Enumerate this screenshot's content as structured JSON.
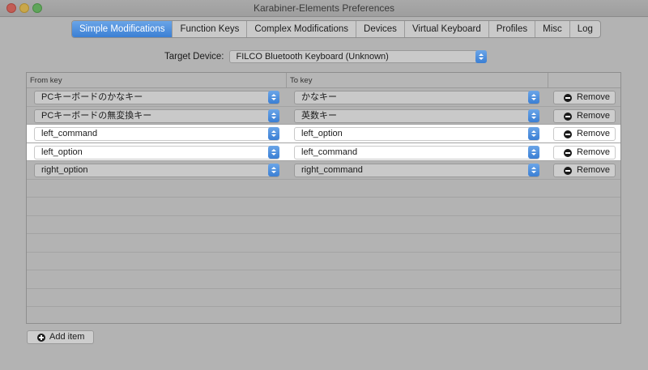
{
  "window": {
    "title": "Karabiner-Elements Preferences"
  },
  "tabs": [
    {
      "label": "Simple Modifications",
      "active": true
    },
    {
      "label": "Function Keys",
      "active": false
    },
    {
      "label": "Complex Modifications",
      "active": false
    },
    {
      "label": "Devices",
      "active": false
    },
    {
      "label": "Virtual Keyboard",
      "active": false
    },
    {
      "label": "Profiles",
      "active": false
    },
    {
      "label": "Misc",
      "active": false
    },
    {
      "label": "Log",
      "active": false
    }
  ],
  "target_device": {
    "label": "Target Device:",
    "value": "FILCO Bluetooth Keyboard (Unknown)"
  },
  "table": {
    "headers": {
      "from": "From key",
      "to": "To key"
    },
    "rows": [
      {
        "from": "PCキーボードのかなキー",
        "to": "かなキー",
        "remove": "Remove",
        "highlighted": false
      },
      {
        "from": "PCキーボードの無変換キー",
        "to": "英数キー",
        "remove": "Remove",
        "highlighted": false
      },
      {
        "from": "left_command",
        "to": "left_option",
        "remove": "Remove",
        "highlighted": true
      },
      {
        "from": "left_option",
        "to": "left_command",
        "remove": "Remove",
        "highlighted": true
      },
      {
        "from": "right_option",
        "to": "right_command",
        "remove": "Remove",
        "highlighted": false
      }
    ],
    "empty_rows": 9
  },
  "add_button": {
    "label": "Add item"
  },
  "colors": {
    "accent": "#3b7fd4",
    "window_bg": "#b3b3b3",
    "highlight": "#ffffff"
  },
  "icons": [
    "close-button",
    "minimize-button",
    "zoom-button",
    "popup-stepper-icon",
    "minus-circle-icon",
    "plus-circle-icon"
  ]
}
